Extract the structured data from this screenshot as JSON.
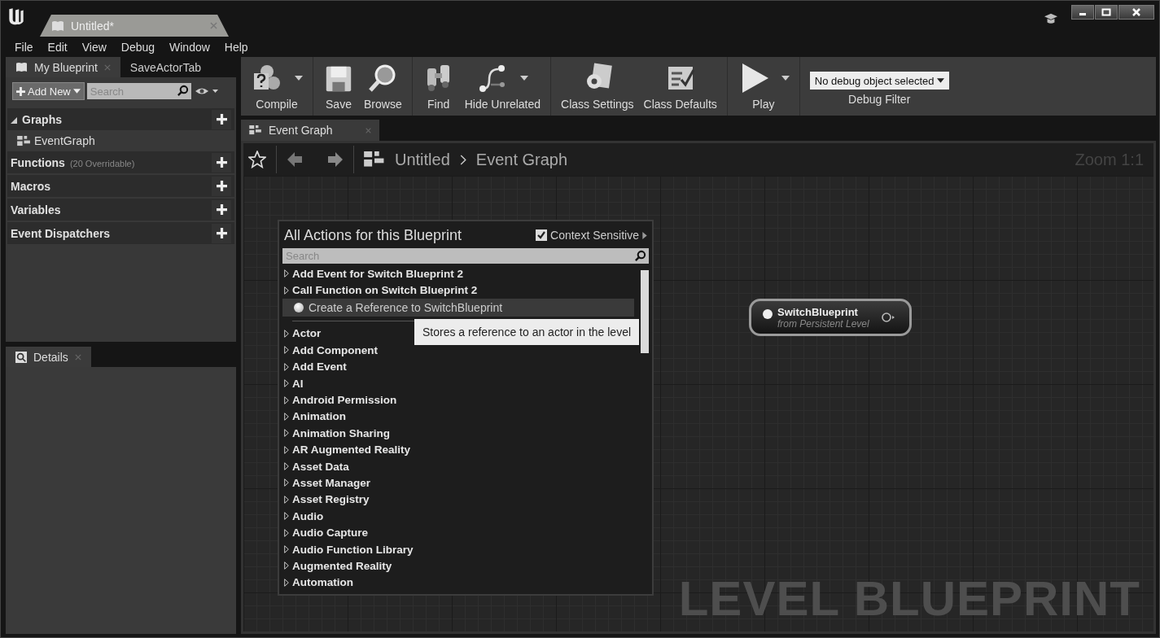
{
  "document_tab": {
    "label": "Untitled*"
  },
  "menu": [
    "File",
    "Edit",
    "View",
    "Debug",
    "Window",
    "Help"
  ],
  "left_tabs": [
    {
      "label": "My Blueprint",
      "selected": true
    },
    {
      "label": "SaveActorTab",
      "selected": false
    }
  ],
  "add_new": "Add New",
  "blueprint_search": {
    "placeholder": "Search"
  },
  "sections": [
    {
      "label": "Graphs",
      "expanded": true,
      "children": [
        {
          "label": "EventGraph"
        }
      ]
    },
    {
      "label": "Functions",
      "note": "(20 Overridable)",
      "expanded": false
    },
    {
      "label": "Macros",
      "expanded": false
    },
    {
      "label": "Variables",
      "expanded": false
    },
    {
      "label": "Event Dispatchers",
      "expanded": false
    }
  ],
  "details_tab": {
    "label": "Details"
  },
  "toolbar": [
    [
      {
        "label": "Compile",
        "kind": "compile",
        "dropdown": true
      }
    ],
    [
      {
        "label": "Save",
        "kind": "save",
        "dropdown": false
      },
      {
        "label": "Browse",
        "kind": "browse",
        "dropdown": false
      }
    ],
    [
      {
        "label": "Find",
        "kind": "find",
        "dropdown": false
      },
      {
        "label": "Hide Unrelated",
        "kind": "hide",
        "dropdown": true
      }
    ],
    [
      {
        "label": "Class Settings",
        "kind": "settings",
        "dropdown": false
      },
      {
        "label": "Class Defaults",
        "kind": "defaults",
        "dropdown": false
      }
    ],
    [
      {
        "label": "Play",
        "kind": "play",
        "dropdown": true
      }
    ]
  ],
  "debug_filter": {
    "value": "No debug object selected",
    "label": "Debug Filter"
  },
  "graph_tab": {
    "label": "Event Graph"
  },
  "breadcrumb": [
    "Untitled",
    "Event Graph"
  ],
  "zoom": "Zoom 1:1",
  "action_menu": {
    "title": "All Actions for this Blueprint",
    "context_sensitive": {
      "label": "Context Sensitive",
      "checked": true
    },
    "search": {
      "placeholder": "Search"
    },
    "items": [
      {
        "label": "Add Event for Switch Blueprint 2",
        "kind": "category",
        "selected": false
      },
      {
        "label": "Call Function on Switch Blueprint 2",
        "kind": "category",
        "selected": false
      },
      {
        "label": "Create a Reference to SwitchBlueprint",
        "kind": "action",
        "selected": true
      },
      {
        "label": "Actor",
        "kind": "category",
        "selected": false
      },
      {
        "label": "Add Component",
        "kind": "category",
        "selected": false
      },
      {
        "label": "Add Event",
        "kind": "category",
        "selected": false
      },
      {
        "label": "AI",
        "kind": "category",
        "selected": false
      },
      {
        "label": "Android Permission",
        "kind": "category",
        "selected": false
      },
      {
        "label": "Animation",
        "kind": "category",
        "selected": false
      },
      {
        "label": "Animation Sharing",
        "kind": "category",
        "selected": false
      },
      {
        "label": "AR Augmented Reality",
        "kind": "category",
        "selected": false
      },
      {
        "label": "Asset Data",
        "kind": "category",
        "selected": false
      },
      {
        "label": "Asset Manager",
        "kind": "category",
        "selected": false
      },
      {
        "label": "Asset Registry",
        "kind": "category",
        "selected": false
      },
      {
        "label": "Audio",
        "kind": "category",
        "selected": false
      },
      {
        "label": "Audio Capture",
        "kind": "category",
        "selected": false
      },
      {
        "label": "Audio Function Library",
        "kind": "category",
        "selected": false
      },
      {
        "label": "Augmented Reality",
        "kind": "category",
        "selected": false
      },
      {
        "label": "Automation",
        "kind": "category",
        "selected": false
      }
    ],
    "tooltip": "Stores a reference to an actor in the level"
  },
  "node": {
    "title": "SwitchBlueprint",
    "subtitle": "from Persistent Level"
  },
  "graph_label": "LEVEL BLUEPRINT"
}
